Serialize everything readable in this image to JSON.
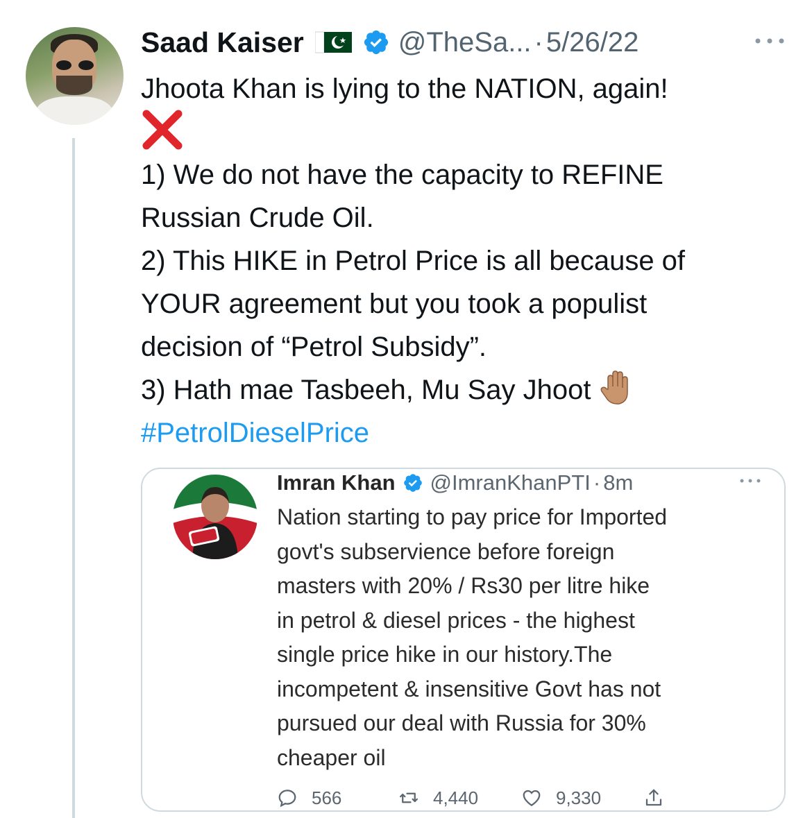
{
  "tweet": {
    "author_name": "Saad Kaiser",
    "handle": "@TheSa...",
    "separator": "·",
    "date": "5/26/22",
    "lines": [
      "Jhoota Khan is lying to the NATION, again!",
      "1) We do not have the capacity to REFINE",
      "Russian Crude Oil.",
      "2) This HIKE in Petrol Price is all because of",
      "YOUR agreement but you took a populist",
      "decision of “Petrol Subsidy”.",
      "3) Hath mae Tasbeeh, Mu Say Jhoot"
    ],
    "hashtag": "#PetrolDieselPrice"
  },
  "quoted_tweet": {
    "author_name": "Imran Khan",
    "handle": "@ImranKhanPTI",
    "separator": "·",
    "time": "8m",
    "lines": [
      "Nation starting to pay price for Imported",
      "govt's subservience before foreign",
      "masters with 20% / Rs30 per litre hike",
      "in petrol & diesel prices - the highest",
      "single price hike in our history.The",
      "incompetent & insensitive Govt has not",
      "pursued our deal with Russia for 30%",
      "cheaper oil"
    ],
    "replies": "566",
    "retweets": "4,440",
    "likes": "9,330"
  },
  "colors": {
    "link_blue": "#1d9bf0",
    "verified_blue": "#1d9bf0",
    "secondary_text": "#536471",
    "border": "#cfd9de",
    "cross_red": "#e0262a"
  },
  "icons": {
    "flag": "pakistan-flag-icon",
    "verified": "verified-badge-icon",
    "more": "more-options-icon",
    "cross": "cross-mark-icon",
    "hand": "raised-hand-icon",
    "reply": "reply-icon",
    "retweet": "retweet-icon",
    "like": "like-icon",
    "share": "share-icon"
  }
}
